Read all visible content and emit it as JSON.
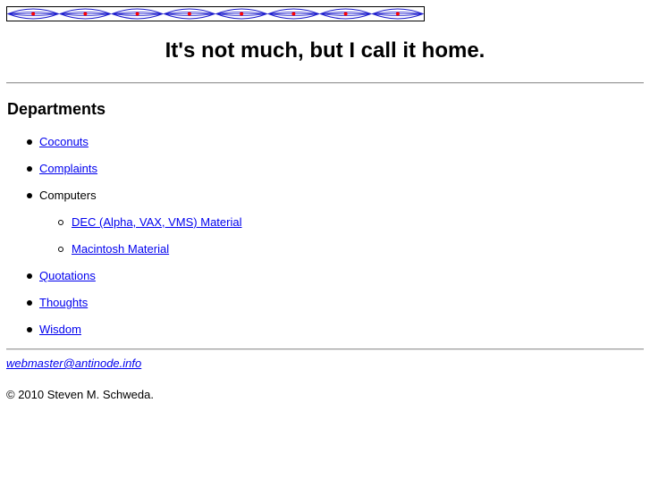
{
  "header": {
    "title": "It's not much, but I call it home."
  },
  "departments": {
    "heading": "Departments",
    "items": [
      {
        "label": "Coconuts",
        "link": true
      },
      {
        "label": "Complaints",
        "link": true
      },
      {
        "label": "Computers",
        "link": false
      },
      {
        "label": "DEC (Alpha, VAX, VMS) Material",
        "link": true
      },
      {
        "label": "Macintosh Material",
        "link": true
      },
      {
        "label": "Quotations",
        "link": true
      },
      {
        "label": "Thoughts",
        "link": true
      },
      {
        "label": "Wisdom",
        "link": true
      }
    ]
  },
  "footer": {
    "email": "webmaster@antinode.info",
    "copyright": "© 2010 Steven M. Schweda."
  },
  "colors": {
    "link": "#0000ee",
    "banner_line": "#1a1acc",
    "banner_dot": "#ff0000"
  },
  "icons": {
    "banner": "lens-chain-banner"
  }
}
